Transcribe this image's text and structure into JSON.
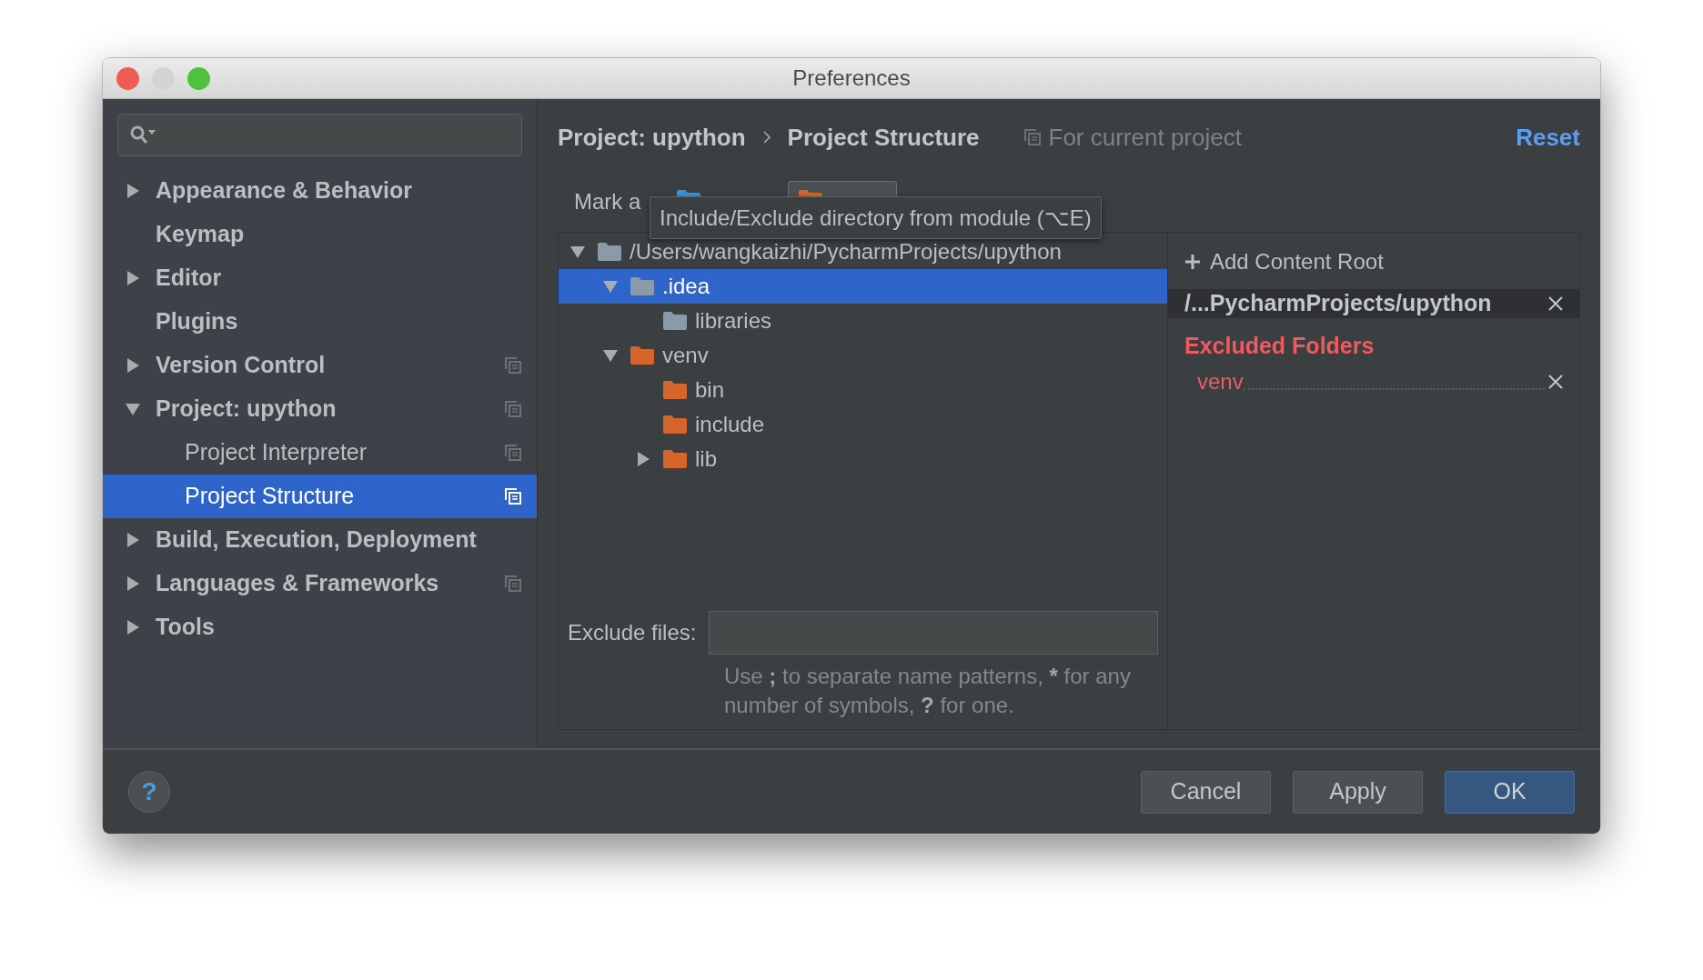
{
  "window": {
    "title": "Preferences"
  },
  "sidebar": {
    "items": [
      {
        "label": "Appearance & Behavior",
        "expanded": false,
        "selected": false,
        "project_level": false
      },
      {
        "label": "Keymap",
        "selected": false,
        "project_level": false
      },
      {
        "label": "Editor",
        "expanded": false,
        "selected": false,
        "project_level": false
      },
      {
        "label": "Plugins",
        "selected": false,
        "project_level": false
      },
      {
        "label": "Version Control",
        "expanded": false,
        "selected": false,
        "project_level": true
      },
      {
        "label": "Project: upython",
        "expanded": true,
        "selected": false,
        "project_level": true,
        "children": [
          {
            "label": "Project Interpreter",
            "selected": false,
            "project_level": true
          },
          {
            "label": "Project Structure",
            "selected": true,
            "project_level": true
          }
        ]
      },
      {
        "label": "Build, Execution, Deployment",
        "expanded": false,
        "selected": false,
        "project_level": false
      },
      {
        "label": "Languages & Frameworks",
        "expanded": false,
        "selected": false,
        "project_level": true
      },
      {
        "label": "Tools",
        "expanded": false,
        "selected": false,
        "project_level": false
      }
    ]
  },
  "header": {
    "breadcrumb": [
      "Project: upython",
      "Project Structure"
    ],
    "scope": "For current project",
    "reset": "Reset"
  },
  "mark_as": {
    "label": "Mark a",
    "options": [
      {
        "kind": "sources",
        "selected": false
      },
      {
        "kind": "excluded",
        "selected": true
      }
    ]
  },
  "tooltip": "Include/Exclude directory from module (⌥E)",
  "tree": [
    {
      "label": "/Users/wangkaizhi/PycharmProjects/upython",
      "kind": "plain",
      "expanded": true,
      "selected": false,
      "children": [
        {
          "label": ".idea",
          "kind": "plain",
          "expanded": true,
          "selected": true,
          "children": [
            {
              "label": "libraries",
              "kind": "plain",
              "selected": false
            }
          ]
        },
        {
          "label": "venv",
          "kind": "excluded",
          "expanded": true,
          "selected": false,
          "children": [
            {
              "label": "bin",
              "kind": "excluded",
              "selected": false
            },
            {
              "label": "include",
              "kind": "excluded",
              "selected": false
            },
            {
              "label": "lib",
              "kind": "excluded",
              "expanded": false,
              "selected": false
            }
          ]
        }
      ]
    }
  ],
  "exclude_files": {
    "label": "Exclude files:",
    "hint": [
      {
        "text": "Use ",
        "bold": false
      },
      {
        "text": ";",
        "bold": true
      },
      {
        "text": " to separate name patterns, ",
        "bold": false
      },
      {
        "text": "*",
        "bold": true
      },
      {
        "text": " for any number of symbols, ",
        "bold": false
      },
      {
        "text": "?",
        "bold": true
      },
      {
        "text": " for one.",
        "bold": false
      }
    ]
  },
  "content_root": {
    "add": "Add Content Root",
    "path": "/...PycharmProjects/upython",
    "excluded_heading": "Excluded Folders",
    "excluded": [
      "venv"
    ]
  },
  "help": "?",
  "buttons": [
    {
      "label": "Cancel",
      "default": false
    },
    {
      "label": "Apply",
      "default": false
    },
    {
      "label": "OK",
      "default": true
    }
  ]
}
